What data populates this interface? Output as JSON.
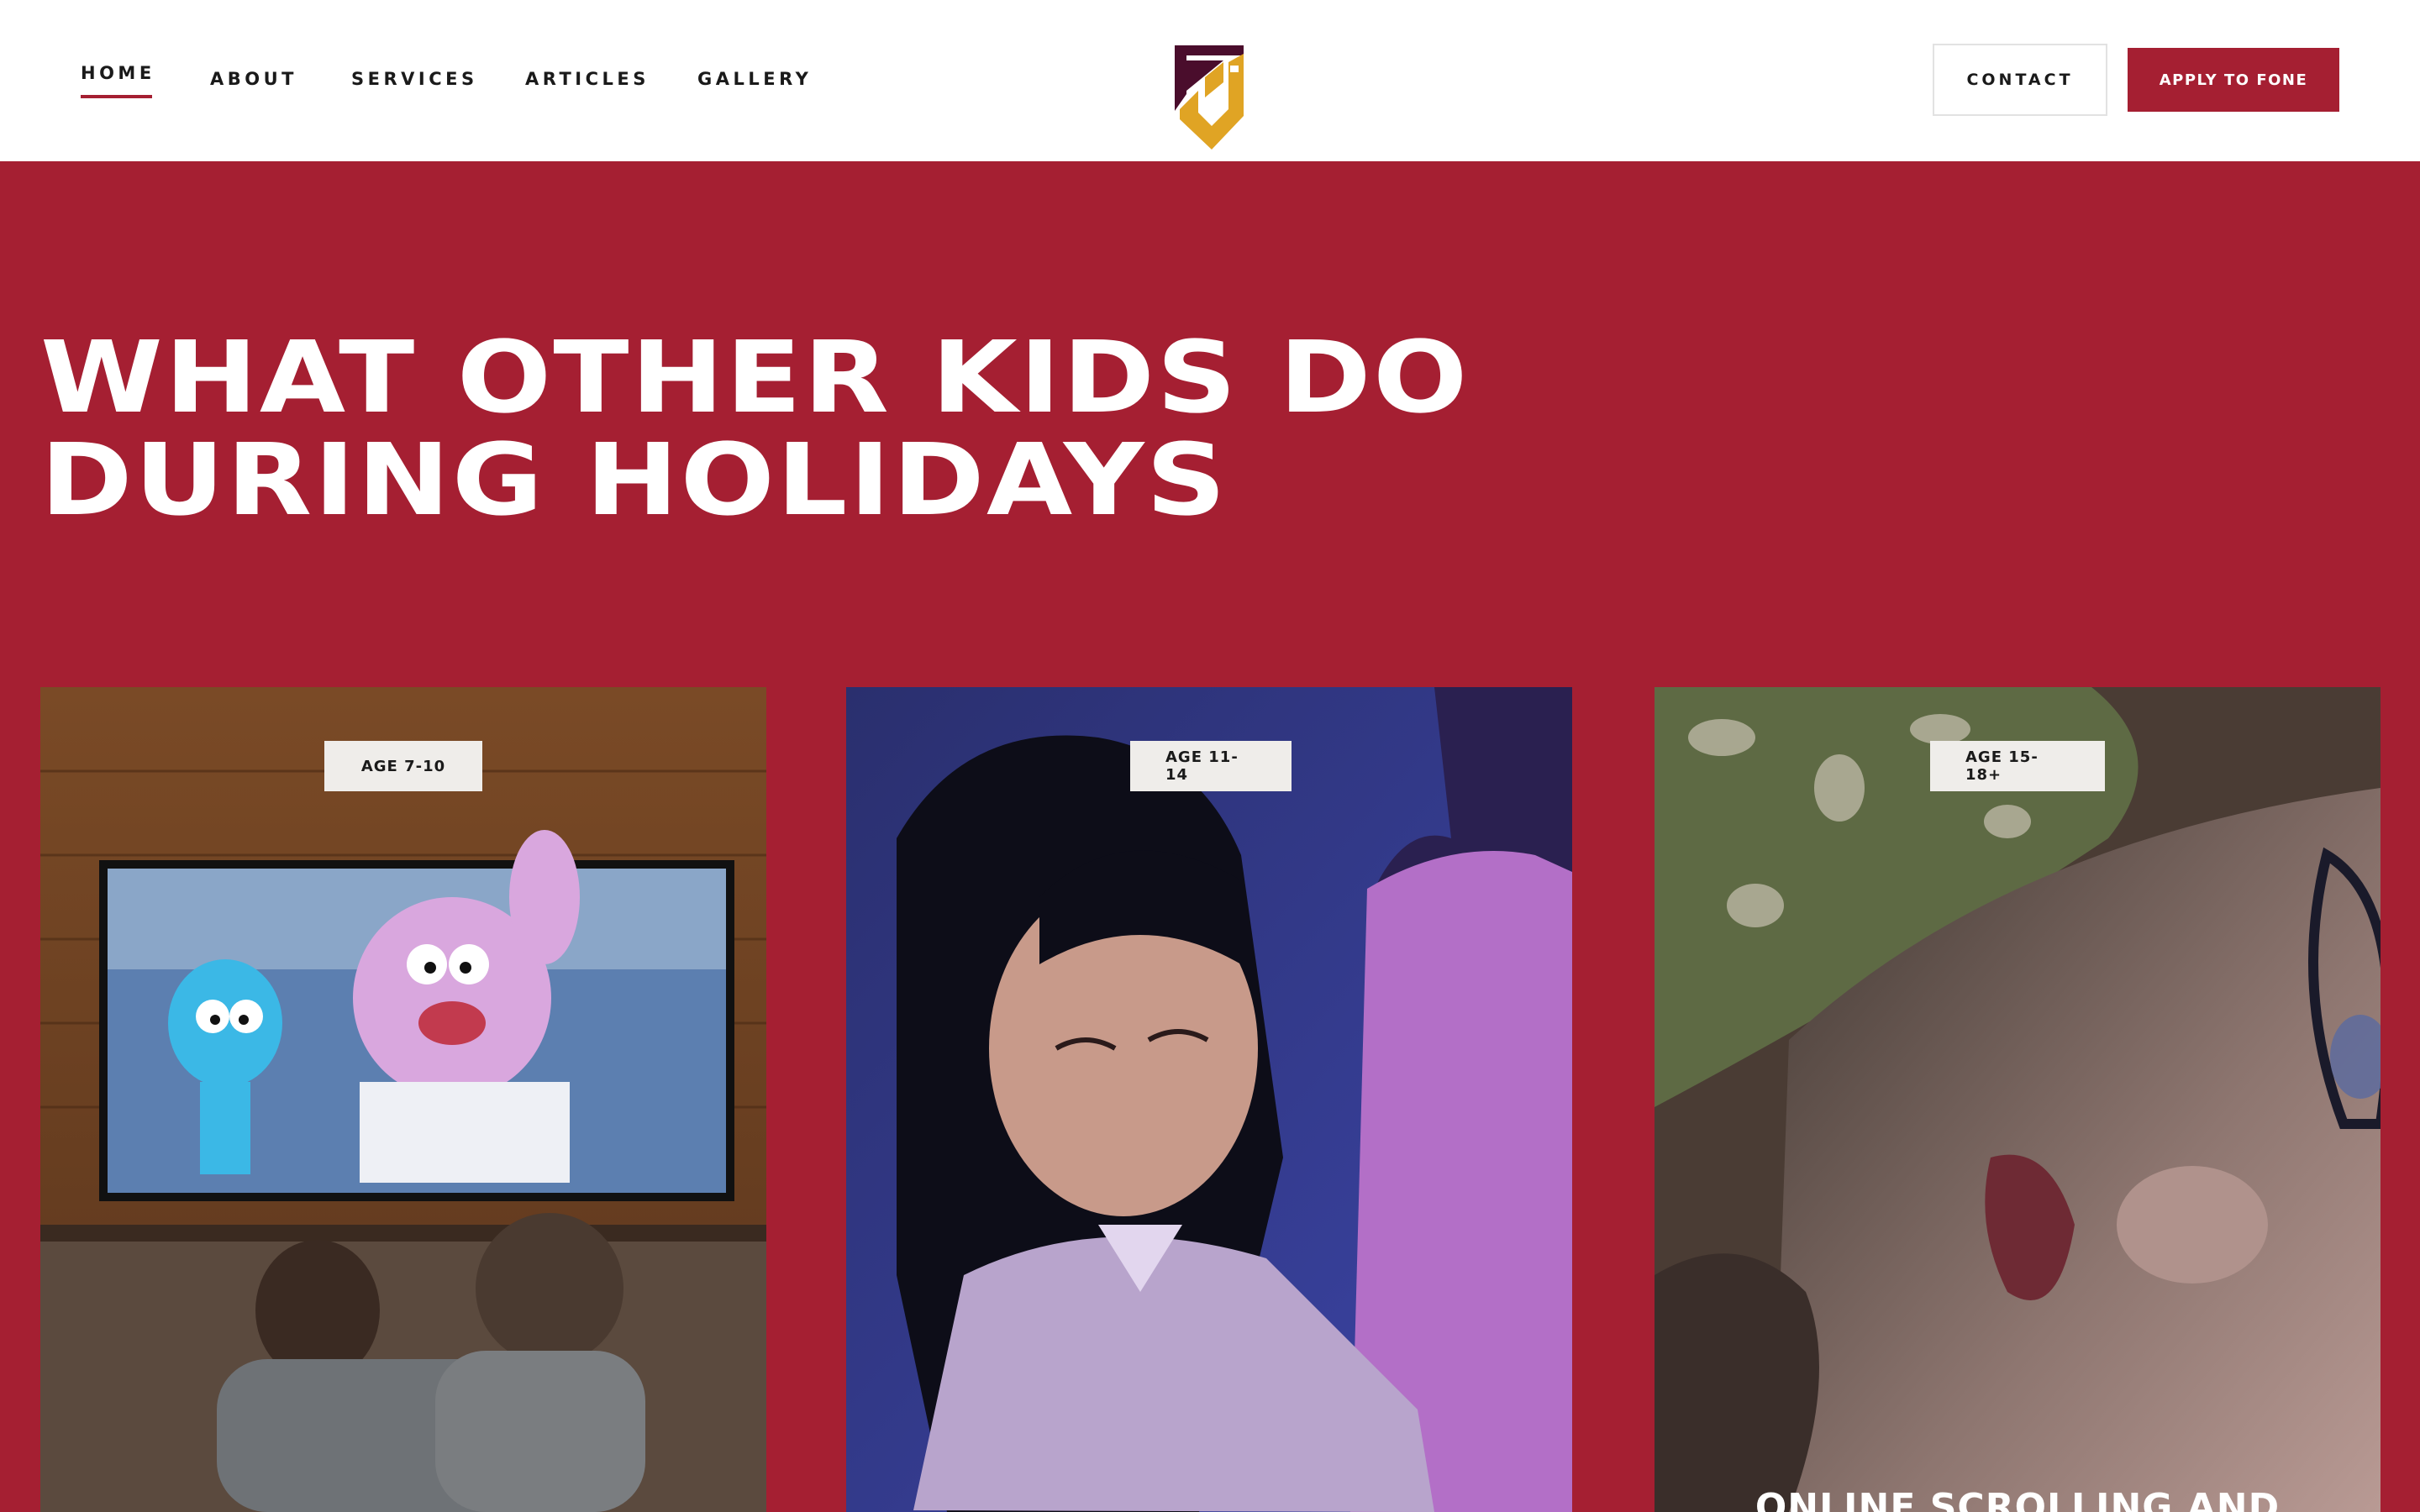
{
  "header": {
    "nav": [
      {
        "label": "HOME",
        "active": true
      },
      {
        "label": "ABOUT",
        "active": false
      },
      {
        "label": "SERVICES",
        "active": false
      },
      {
        "label": "ARTICLES",
        "active": false
      },
      {
        "label": "GALLERY",
        "active": false
      }
    ],
    "contact_label": "CONTACT",
    "apply_label": "APPLY TO FONE"
  },
  "hero": {
    "title_line1": "WHAT OTHER KIDS DO",
    "title_line2": "DURING HOLIDAYS"
  },
  "cards": [
    {
      "age": "AGE 7-10",
      "caption": ""
    },
    {
      "age": "AGE 11-14",
      "caption": ""
    },
    {
      "age": "AGE 15-18+",
      "caption": "ONLINE SCROLLING AND"
    }
  ],
  "colors": {
    "brand_red": "#a51f32",
    "logo_purple": "#4a0d2c",
    "logo_gold": "#e0a424",
    "header_bg": "#ffffff",
    "tag_bg": "#efedea"
  }
}
